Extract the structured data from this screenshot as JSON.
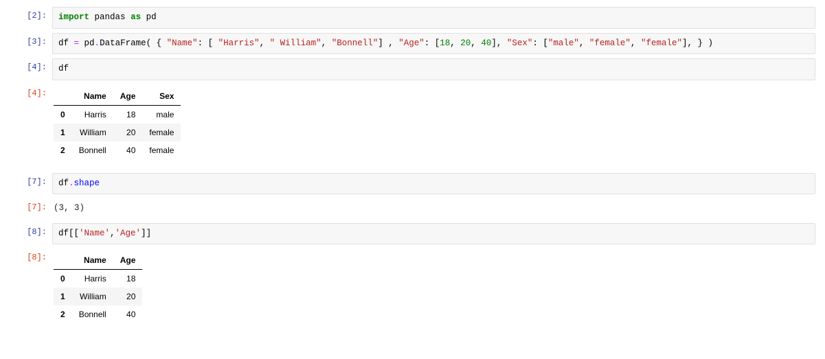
{
  "cells": {
    "c2": {
      "prompt": "[2]:",
      "tokens": [
        {
          "t": "import",
          "c": "kw"
        },
        {
          "t": " ",
          "c": "nm"
        },
        {
          "t": "pandas",
          "c": "nm"
        },
        {
          "t": " ",
          "c": "nm"
        },
        {
          "t": "as",
          "c": "kw"
        },
        {
          "t": " ",
          "c": "nm"
        },
        {
          "t": "pd",
          "c": "nm"
        }
      ]
    },
    "c3": {
      "prompt": "[3]:",
      "tokens": [
        {
          "t": "df ",
          "c": "nm"
        },
        {
          "t": "=",
          "c": "op"
        },
        {
          "t": " pd",
          "c": "nm"
        },
        {
          "t": ".",
          "c": "op"
        },
        {
          "t": "DataFrame",
          "c": "nm"
        },
        {
          "t": "( { ",
          "c": "nm"
        },
        {
          "t": "\"Name\"",
          "c": "st"
        },
        {
          "t": ": [ ",
          "c": "nm"
        },
        {
          "t": "\"Harris\"",
          "c": "st"
        },
        {
          "t": ", ",
          "c": "nm"
        },
        {
          "t": "\" William\"",
          "c": "st"
        },
        {
          "t": ", ",
          "c": "nm"
        },
        {
          "t": "\"Bonnell\"",
          "c": "st"
        },
        {
          "t": "] , ",
          "c": "nm"
        },
        {
          "t": "\"Age\"",
          "c": "st"
        },
        {
          "t": ": [",
          "c": "nm"
        },
        {
          "t": "18",
          "c": "num"
        },
        {
          "t": ", ",
          "c": "nm"
        },
        {
          "t": "20",
          "c": "num"
        },
        {
          "t": ", ",
          "c": "nm"
        },
        {
          "t": "40",
          "c": "num"
        },
        {
          "t": "], ",
          "c": "nm"
        },
        {
          "t": "\"Sex\"",
          "c": "st"
        },
        {
          "t": ": [",
          "c": "nm"
        },
        {
          "t": "\"male\"",
          "c": "st"
        },
        {
          "t": ", ",
          "c": "nm"
        },
        {
          "t": "\"female\"",
          "c": "st"
        },
        {
          "t": ", ",
          "c": "nm"
        },
        {
          "t": "\"female\"",
          "c": "st"
        },
        {
          "t": "], } )",
          "c": "nm"
        }
      ]
    },
    "c4in": {
      "prompt": "[4]:",
      "tokens": [
        {
          "t": "df",
          "c": "nm"
        }
      ]
    },
    "c4out": {
      "prompt": "[4]:",
      "columns": [
        "Name",
        "Age",
        "Sex"
      ],
      "index": [
        "0",
        "1",
        "2"
      ],
      "rows": [
        [
          "Harris",
          "18",
          "male"
        ],
        [
          "William",
          "20",
          "female"
        ],
        [
          "Bonnell",
          "40",
          "female"
        ]
      ]
    },
    "c7in": {
      "prompt": "[7]:",
      "tokens": [
        {
          "t": "df",
          "c": "nm"
        },
        {
          "t": ".",
          "c": "op"
        },
        {
          "t": "shape",
          "c": "fn"
        }
      ]
    },
    "c7out": {
      "prompt": "[7]:",
      "text": "(3, 3)"
    },
    "c8in": {
      "prompt": "[8]:",
      "tokens": [
        {
          "t": "df[[",
          "c": "nm"
        },
        {
          "t": "'Name'",
          "c": "st"
        },
        {
          "t": ",",
          "c": "nm"
        },
        {
          "t": "'Age'",
          "c": "st"
        },
        {
          "t": "]]",
          "c": "nm"
        }
      ]
    },
    "c8out": {
      "prompt": "[8]:",
      "columns": [
        "Name",
        "Age"
      ],
      "index": [
        "0",
        "1",
        "2"
      ],
      "rows": [
        [
          "Harris",
          "18"
        ],
        [
          "William",
          "20"
        ],
        [
          "Bonnell",
          "40"
        ]
      ]
    }
  }
}
